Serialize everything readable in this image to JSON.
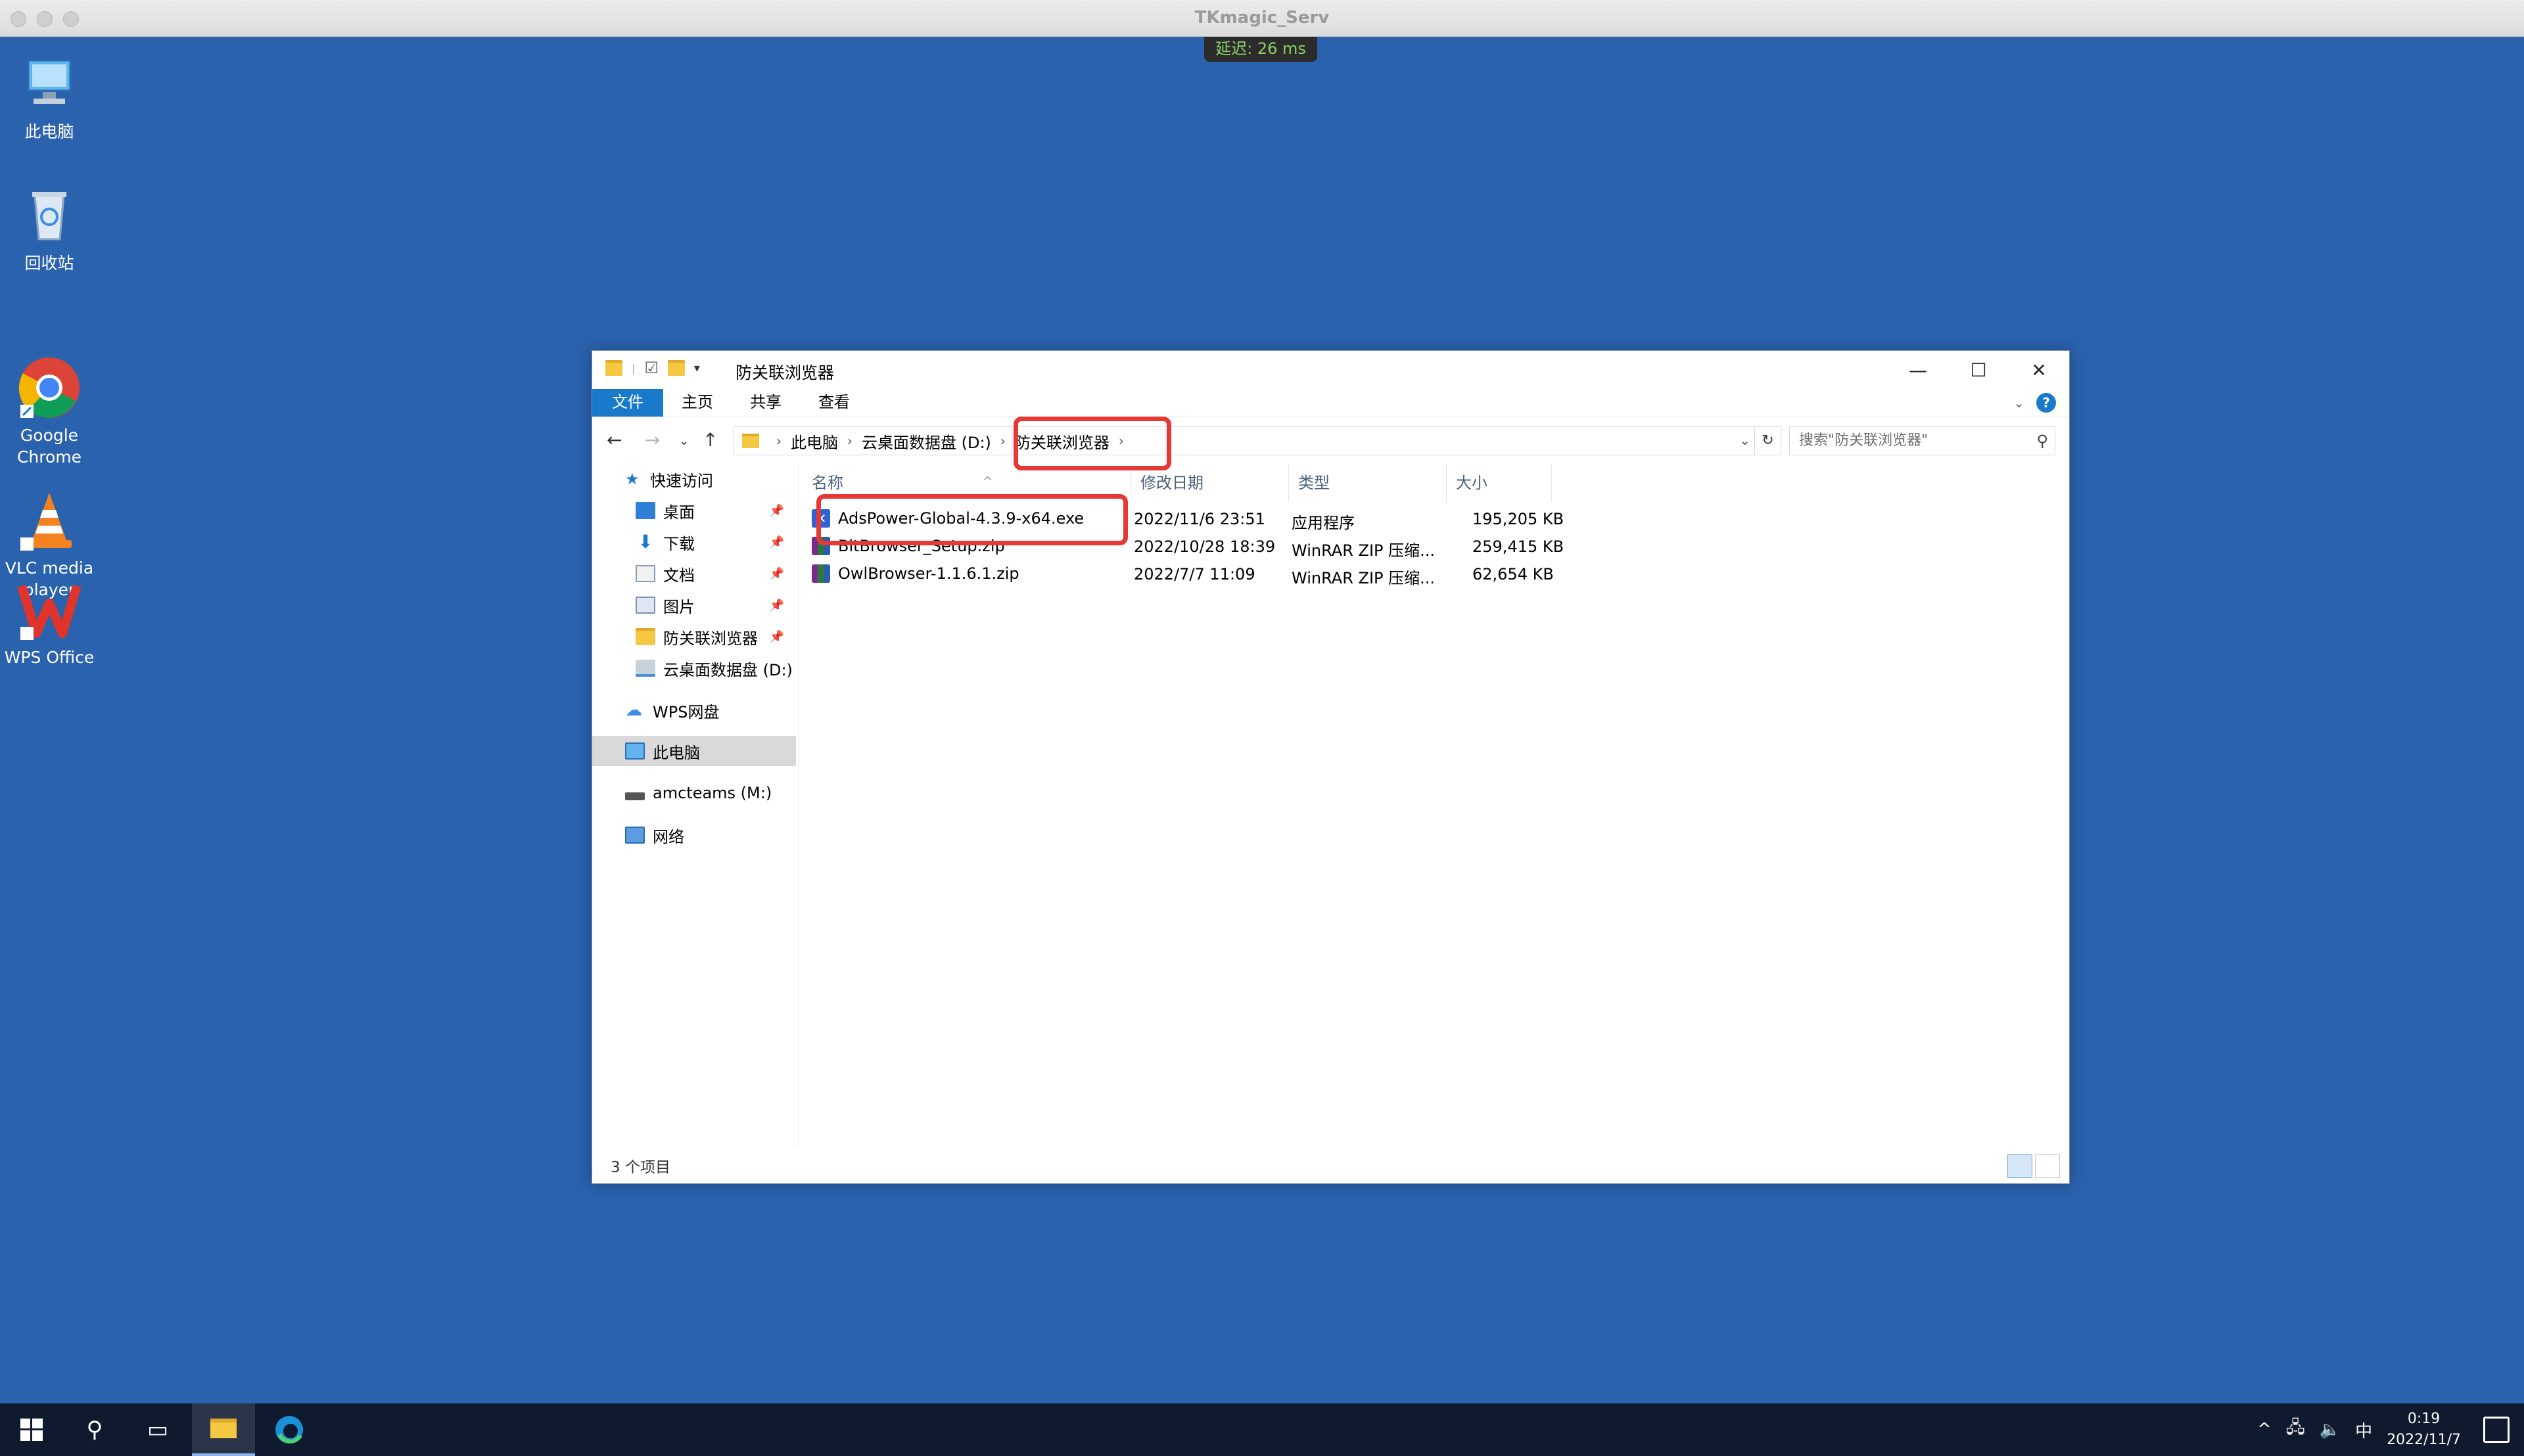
{
  "host": {
    "title": "TKmagic_Serv",
    "latency": "延迟: 26 ms"
  },
  "desktop": [
    {
      "label": "此电脑"
    },
    {
      "label": "回收站"
    },
    {
      "label": "Google\nChrome"
    },
    {
      "label": "VLC media\nplayer"
    },
    {
      "label": "WPS Office"
    }
  ],
  "window": {
    "title": "防关联浏览器",
    "controls": {
      "minimize": "—",
      "maximize": "☐",
      "close": "✕"
    },
    "ribbon_tabs": [
      "文件",
      "主页",
      "共享",
      "查看"
    ],
    "address": [
      "此电脑",
      "云桌面数据盘 (D:)",
      "防关联浏览器"
    ],
    "search_placeholder": "搜索\"防关联浏览器\"",
    "nav_pane": [
      {
        "label": "快速访问",
        "pinned": false
      },
      {
        "label": "桌面",
        "pinned": true
      },
      {
        "label": "下载",
        "pinned": true
      },
      {
        "label": "文档",
        "pinned": true
      },
      {
        "label": "图片",
        "pinned": true
      },
      {
        "label": "防关联浏览器",
        "pinned": true
      },
      {
        "label": "云桌面数据盘 (D:)",
        "pinned": false
      },
      {
        "label": "WPS网盘",
        "pinned": false
      },
      {
        "label": "此电脑",
        "pinned": false
      },
      {
        "label": "amcteams (M:)",
        "pinned": false
      },
      {
        "label": "网络",
        "pinned": false
      }
    ],
    "columns": [
      "名称",
      "修改日期",
      "类型",
      "大小"
    ],
    "files": [
      {
        "name": "AdsPower-Global-4.3.9-x64.exe",
        "date": "2022/11/6 23:51",
        "type": "应用程序",
        "size": "195,205 KB"
      },
      {
        "name": "BitBrowser_Setup.zip",
        "date": "2022/10/28 18:39",
        "type": "WinRAR ZIP 压缩...",
        "size": "259,415 KB"
      },
      {
        "name": "OwlBrowser-1.1.6.1.zip",
        "date": "2022/7/7 11:09",
        "type": "WinRAR ZIP 压缩...",
        "size": "62,654 KB"
      }
    ],
    "status": "3 个项目"
  },
  "taskbar": {
    "ime": "中",
    "time": "0:19",
    "date": "2022/11/7"
  },
  "colors": {
    "desktop": "#2a62ad",
    "accent": "#1979ca",
    "highlight": "#e53935"
  }
}
